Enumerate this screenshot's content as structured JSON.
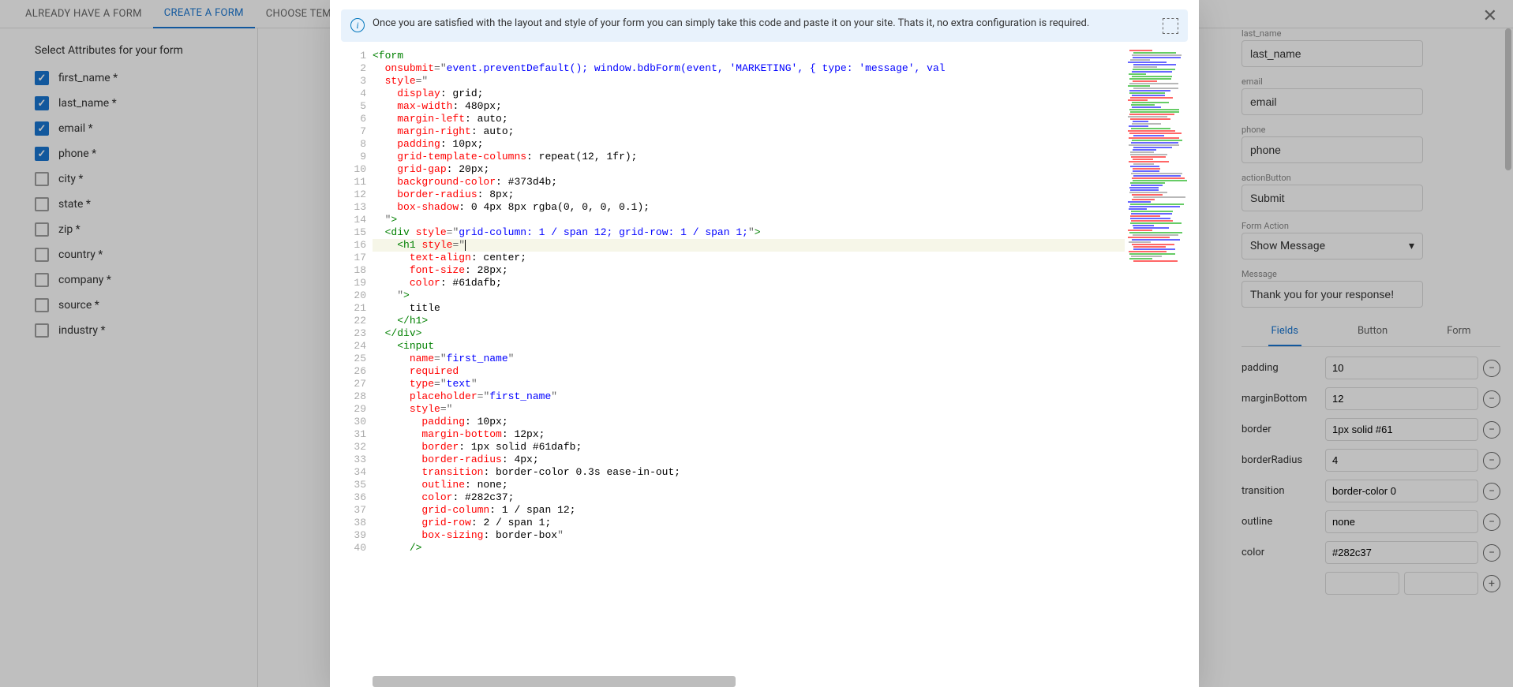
{
  "tabs": [
    "ALREADY HAVE A FORM",
    "CREATE A FORM",
    "CHOOSE TEMPLAT"
  ],
  "activeTab": 1,
  "leftTitle": "Select Attributes for your form",
  "attributes": [
    {
      "label": "first_name *",
      "checked": true
    },
    {
      "label": "last_name *",
      "checked": true
    },
    {
      "label": "email *",
      "checked": true
    },
    {
      "label": "phone *",
      "checked": true
    },
    {
      "label": "city *",
      "checked": false
    },
    {
      "label": "state *",
      "checked": false
    },
    {
      "label": "zip *",
      "checked": false
    },
    {
      "label": "country *",
      "checked": false
    },
    {
      "label": "company *",
      "checked": false
    },
    {
      "label": "source *",
      "checked": false
    },
    {
      "label": "industry *",
      "checked": false
    }
  ],
  "banner": "Once you are satisfied with the layout and style of your form you can simply take this code and paste it on your site. Thats it, no extra configuration is required.",
  "code": [
    [
      [
        "tag",
        "<form"
      ]
    ],
    [
      [
        "text",
        "  "
      ],
      [
        "attr",
        "onsubmit"
      ],
      [
        "sym",
        "=\""
      ],
      [
        "str",
        "event.preventDefault(); window.bdbForm(event, 'MARKETING', { type: 'message', val"
      ]
    ],
    [
      [
        "text",
        "  "
      ],
      [
        "attr",
        "style"
      ],
      [
        "sym",
        "=\""
      ]
    ],
    [
      [
        "text",
        "    "
      ],
      [
        "attr",
        "display"
      ],
      [
        "text",
        ": grid;"
      ]
    ],
    [
      [
        "text",
        "    "
      ],
      [
        "attr",
        "max-width"
      ],
      [
        "text",
        ": 480px;"
      ]
    ],
    [
      [
        "text",
        "    "
      ],
      [
        "attr",
        "margin-left"
      ],
      [
        "text",
        ": auto;"
      ]
    ],
    [
      [
        "text",
        "    "
      ],
      [
        "attr",
        "margin-right"
      ],
      [
        "text",
        ": auto;"
      ]
    ],
    [
      [
        "text",
        "    "
      ],
      [
        "attr",
        "padding"
      ],
      [
        "text",
        ": 10px;"
      ]
    ],
    [
      [
        "text",
        "    "
      ],
      [
        "attr",
        "grid-template-columns"
      ],
      [
        "text",
        ": repeat(12, 1fr);"
      ]
    ],
    [
      [
        "text",
        "    "
      ],
      [
        "attr",
        "grid-gap"
      ],
      [
        "text",
        ": 20px;"
      ]
    ],
    [
      [
        "text",
        "    "
      ],
      [
        "attr",
        "background-color"
      ],
      [
        "text",
        ": #373d4b;"
      ]
    ],
    [
      [
        "text",
        "    "
      ],
      [
        "attr",
        "border-radius"
      ],
      [
        "text",
        ": 8px;"
      ]
    ],
    [
      [
        "text",
        "    "
      ],
      [
        "attr",
        "box-shadow"
      ],
      [
        "text",
        ": 0 4px 8px rgba(0, 0, 0, 0.1);"
      ]
    ],
    [
      [
        "text",
        "  "
      ],
      [
        "sym",
        "\""
      ],
      [
        "tag",
        ">"
      ]
    ],
    [
      [
        "text",
        "  "
      ],
      [
        "tag",
        "<div"
      ],
      [
        "text",
        " "
      ],
      [
        "attr",
        "style"
      ],
      [
        "sym",
        "=\""
      ],
      [
        "str",
        "grid-column: 1 / span 12; grid-row: 1 / span 1;"
      ],
      [
        "sym",
        "\""
      ],
      [
        "tag",
        ">"
      ]
    ],
    [
      [
        "text",
        "    "
      ],
      [
        "tag",
        "<h1"
      ],
      [
        "text",
        " "
      ],
      [
        "attr",
        "style"
      ],
      [
        "sym",
        "=\""
      ]
    ],
    [
      [
        "text",
        "      "
      ],
      [
        "attr",
        "text-align"
      ],
      [
        "text",
        ": center;"
      ]
    ],
    [
      [
        "text",
        "      "
      ],
      [
        "attr",
        "font-size"
      ],
      [
        "text",
        ": 28px;"
      ]
    ],
    [
      [
        "text",
        "      "
      ],
      [
        "attr",
        "color"
      ],
      [
        "text",
        ": #61dafb;"
      ]
    ],
    [
      [
        "text",
        "    "
      ],
      [
        "sym",
        "\""
      ],
      [
        "tag",
        ">"
      ]
    ],
    [
      [
        "text",
        "      title"
      ]
    ],
    [
      [
        "text",
        "    "
      ],
      [
        "tag",
        "</h1>"
      ]
    ],
    [
      [
        "text",
        "  "
      ],
      [
        "tag",
        "</div>"
      ]
    ],
    [
      [
        "text",
        "    "
      ],
      [
        "tag",
        "<input"
      ]
    ],
    [
      [
        "text",
        "      "
      ],
      [
        "attr",
        "name"
      ],
      [
        "sym",
        "=\""
      ],
      [
        "str",
        "first_name"
      ],
      [
        "sym",
        "\""
      ]
    ],
    [
      [
        "text",
        "      "
      ],
      [
        "attr",
        "required"
      ]
    ],
    [
      [
        "text",
        "      "
      ],
      [
        "attr",
        "type"
      ],
      [
        "sym",
        "=\""
      ],
      [
        "str",
        "text"
      ],
      [
        "sym",
        "\""
      ]
    ],
    [
      [
        "text",
        "      "
      ],
      [
        "attr",
        "placeholder"
      ],
      [
        "sym",
        "=\""
      ],
      [
        "str",
        "first_name"
      ],
      [
        "sym",
        "\""
      ]
    ],
    [
      [
        "text",
        "      "
      ],
      [
        "attr",
        "style"
      ],
      [
        "sym",
        "=\""
      ]
    ],
    [
      [
        "text",
        "        "
      ],
      [
        "attr",
        "padding"
      ],
      [
        "text",
        ": 10px;"
      ]
    ],
    [
      [
        "text",
        "        "
      ],
      [
        "attr",
        "margin-bottom"
      ],
      [
        "text",
        ": 12px;"
      ]
    ],
    [
      [
        "text",
        "        "
      ],
      [
        "attr",
        "border"
      ],
      [
        "text",
        ": 1px solid #61dafb;"
      ]
    ],
    [
      [
        "text",
        "        "
      ],
      [
        "attr",
        "border-radius"
      ],
      [
        "text",
        ": 4px;"
      ]
    ],
    [
      [
        "text",
        "        "
      ],
      [
        "attr",
        "transition"
      ],
      [
        "text",
        ": border-color 0.3s ease-in-out;"
      ]
    ],
    [
      [
        "text",
        "        "
      ],
      [
        "attr",
        "outline"
      ],
      [
        "text",
        ": none;"
      ]
    ],
    [
      [
        "text",
        "        "
      ],
      [
        "attr",
        "color"
      ],
      [
        "text",
        ": #282c37;"
      ]
    ],
    [
      [
        "text",
        "        "
      ],
      [
        "attr",
        "grid-column"
      ],
      [
        "text",
        ": 1 / span 12;"
      ]
    ],
    [
      [
        "text",
        "        "
      ],
      [
        "attr",
        "grid-row"
      ],
      [
        "text",
        ": 2 / span 1;"
      ]
    ],
    [
      [
        "text",
        "        "
      ],
      [
        "attr",
        "box-sizing"
      ],
      [
        "text",
        ": border-box"
      ],
      [
        "sym",
        "\""
      ]
    ],
    [
      [
        "text",
        "      "
      ],
      [
        "tag",
        "/>"
      ]
    ]
  ],
  "highlightLine": 16,
  "rightFields": [
    {
      "label": "last_name",
      "value": "last_name"
    },
    {
      "label": "email",
      "value": "email"
    },
    {
      "label": "phone",
      "value": "phone"
    },
    {
      "label": "actionButton",
      "value": "Submit"
    }
  ],
  "formAction": {
    "label": "Form Action",
    "value": "Show Message"
  },
  "message": {
    "label": "Message",
    "value": "Thank you for your response!"
  },
  "subTabs": [
    "Fields",
    "Button",
    "Form"
  ],
  "activeSubTab": 0,
  "styleRows": [
    {
      "k": "padding",
      "v": "10"
    },
    {
      "k": "marginBottom",
      "v": "12"
    },
    {
      "k": "border",
      "v": "1px solid #61"
    },
    {
      "k": "borderRadius",
      "v": "4"
    },
    {
      "k": "transition",
      "v": "border-color 0"
    },
    {
      "k": "outline",
      "v": "none"
    },
    {
      "k": "color",
      "v": "#282c37"
    }
  ]
}
